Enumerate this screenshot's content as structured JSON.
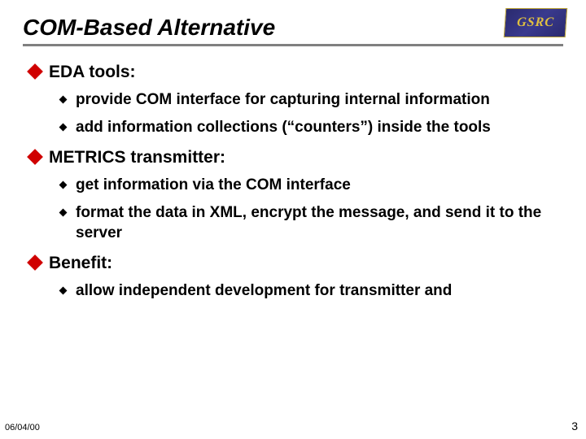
{
  "title": "COM-Based Alternative",
  "logo_text": "GSRC",
  "sections": [
    {
      "heading": "EDA tools:",
      "items": [
        "provide COM interface for capturing internal information",
        "add information collections (“counters”) inside the tools"
      ]
    },
    {
      "heading": "METRICS transmitter:",
      "items": [
        "get information via the COM interface",
        "format the data in XML, encrypt the message, and send it to the server"
      ]
    },
    {
      "heading": "Benefit:",
      "items": [
        "allow independent development for transmitter and"
      ]
    }
  ],
  "footer": {
    "date": "06/04/00",
    "page": "3"
  }
}
